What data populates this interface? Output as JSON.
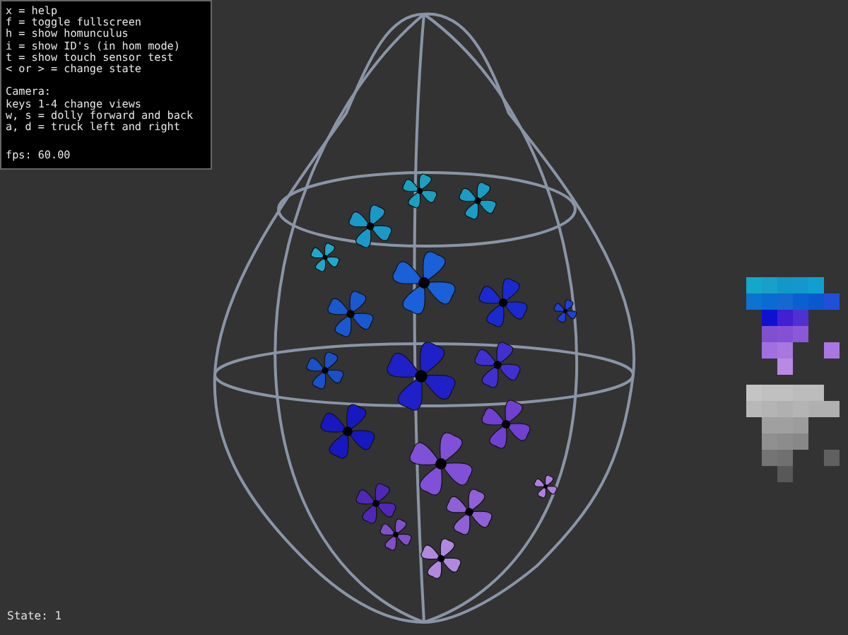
{
  "help_panel": {
    "keys": [
      "x = help",
      "f = toggle fullscreen",
      "h = show homunculus",
      "i = show ID's (in hom mode)",
      "t = show touch sensor test",
      "< or > = change state"
    ],
    "camera": [
      "Camera:",
      "keys 1-4 change views",
      "w, s = dolly forward and back",
      "a, d = truck left and right"
    ],
    "fps": "fps: 60.00"
  },
  "status": {
    "state": "State: 1"
  }
}
